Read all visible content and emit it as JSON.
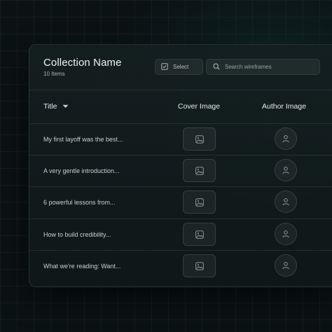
{
  "collection": {
    "title": "Collection Name",
    "count": "10 Items"
  },
  "toolbar": {
    "select_label": "Select",
    "search_placeholder": "Search wireframes"
  },
  "table": {
    "headers": {
      "title": "Title",
      "cover": "Cover Image",
      "author": "Author Image"
    },
    "rows": [
      {
        "title": "My first layoff was the best..."
      },
      {
        "title": "A very gentle introduction..."
      },
      {
        "title": "6 powerful lessons from..."
      },
      {
        "title": "How to build credibility..."
      },
      {
        "title": "What we're reading: Want..."
      }
    ]
  },
  "icons": {
    "select": "checkbox-icon",
    "search": "search-icon",
    "sort": "caret-down-icon",
    "cover": "image-icon",
    "author": "user-icon"
  }
}
